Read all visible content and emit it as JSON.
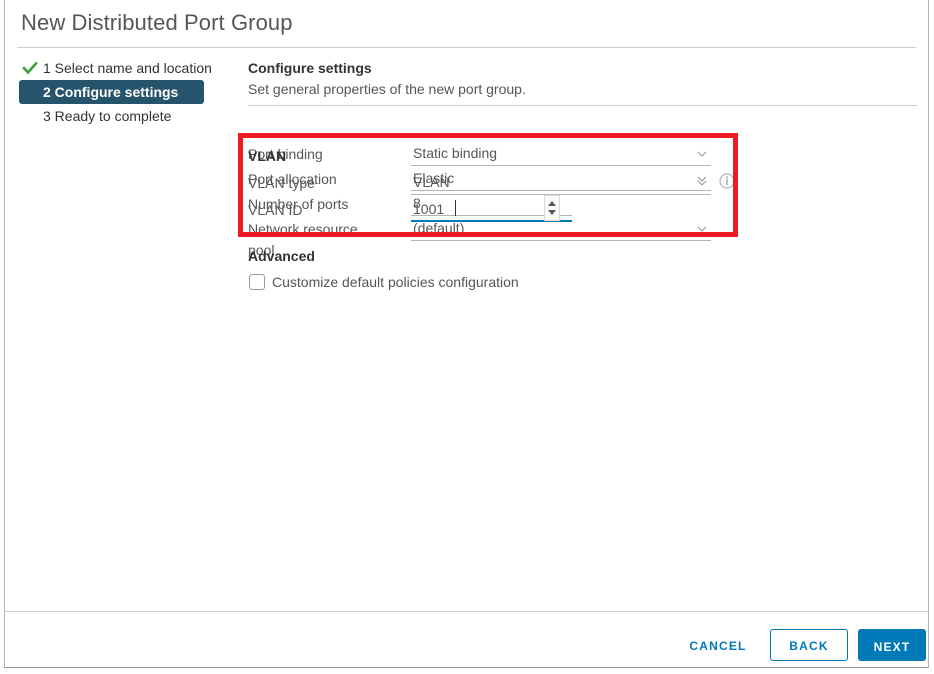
{
  "dialog": {
    "title": "New Distributed Port Group"
  },
  "steps": [
    {
      "label": "1 Select name and location",
      "state": "completed",
      "icon": "check-icon"
    },
    {
      "label": "2 Configure settings",
      "state": "active",
      "icon": ""
    },
    {
      "label": "3 Ready to complete",
      "state": "pending",
      "icon": ""
    }
  ],
  "pane": {
    "title": "Configure settings",
    "subtitle": "Set general properties of the new port group."
  },
  "settings": {
    "rows": [
      {
        "label": "Port binding",
        "value": "Static binding",
        "control": "dropdown"
      },
      {
        "label": "Port allocation",
        "value": "Elastic",
        "control": "dropdown"
      },
      {
        "label": "Number of ports",
        "value": "8",
        "control": "text"
      },
      {
        "label": "Network resource",
        "label2": "pool",
        "value": "(default)",
        "control": "dropdown"
      }
    ],
    "info_icon": "info-icon"
  },
  "vlan": {
    "heading": "VLAN",
    "type_label": "VLAN type",
    "type_value": "VLAN",
    "id_label": "VLAN ID",
    "id_value": "1001",
    "highlight_color": "#ed1c24"
  },
  "advanced": {
    "heading": "Advanced",
    "checkbox_label": "Customize default policies configuration",
    "checked": false
  },
  "footer": {
    "cancel": "CANCEL",
    "back": "BACK",
    "next": "NEXT"
  },
  "colors": {
    "accent": "#0079b8",
    "active_step": "#25546c",
    "check_green": "#3c9f3c",
    "highlight_red": "#ed1c24"
  }
}
